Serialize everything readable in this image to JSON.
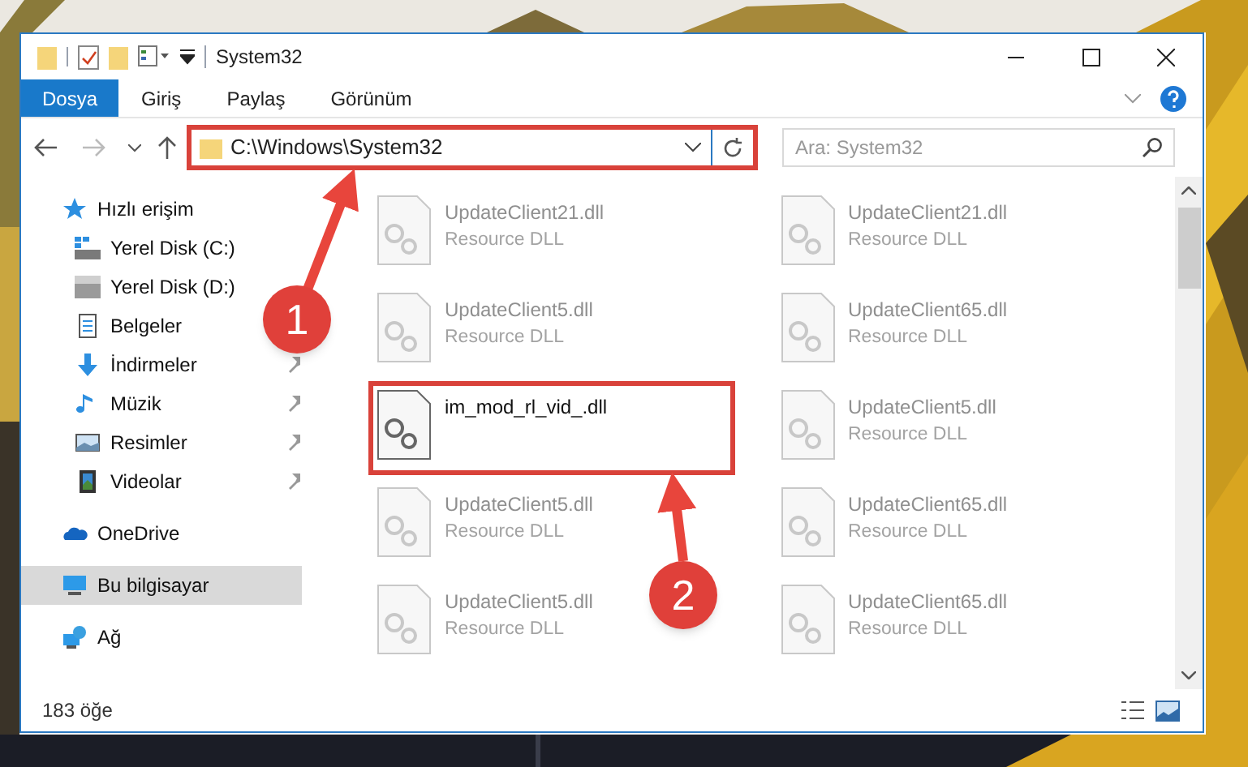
{
  "window": {
    "title": "System32"
  },
  "ribbon_tabs": [
    {
      "label": "Dosya",
      "kind": "file"
    },
    {
      "label": "Giriş",
      "kind": "tab"
    },
    {
      "label": "Paylaş",
      "kind": "tab"
    },
    {
      "label": "Görünüm",
      "kind": "tab"
    }
  ],
  "address_bar": {
    "path": "C:\\Windows\\System32",
    "highlighted": true
  },
  "search": {
    "placeholder": "Ara: System32"
  },
  "navigation": [
    {
      "label": "Hızlı erişim",
      "kind": "star",
      "selected": false,
      "children": [
        {
          "label": "Yerel Disk (C:)",
          "kind": "drive-c",
          "pinned": false,
          "selected": false
        },
        {
          "label": "Yerel Disk (D:)",
          "kind": "drive",
          "pinned": false,
          "selected": false
        },
        {
          "label": "Belgeler",
          "kind": "documents",
          "pinned": false,
          "selected": false
        },
        {
          "label": "İndirmeler",
          "kind": "download",
          "pinned": true,
          "selected": false
        },
        {
          "label": "Müzik",
          "kind": "music",
          "pinned": true,
          "selected": false
        },
        {
          "label": "Resimler",
          "kind": "pictures",
          "pinned": true,
          "selected": false
        },
        {
          "label": "Videolar",
          "kind": "videos",
          "pinned": true,
          "selected": false
        }
      ]
    },
    {
      "label": "OneDrive",
      "kind": "cloud",
      "selected": false
    },
    {
      "label": "Bu bilgisayar",
      "kind": "computer",
      "selected": true
    },
    {
      "label": "Ağ",
      "kind": "network",
      "selected": false
    }
  ],
  "files": [
    {
      "name": "UpdateClient21.dll",
      "type": "Resource DLL",
      "blurred": true,
      "highlighted": false
    },
    {
      "name": "UpdateClient21.dll",
      "type": "Resource DLL",
      "blurred": true,
      "highlighted": false
    },
    {
      "name": "UpdateClient5.dll",
      "type": "Resource DLL",
      "blurred": true,
      "highlighted": false
    },
    {
      "name": "UpdateClient65.dll",
      "type": "Resource DLL",
      "blurred": true,
      "highlighted": false
    },
    {
      "name": "im_mod_rl_vid_.dll",
      "blurred": false,
      "highlighted": true
    },
    {
      "name": "UpdateClient5.dll",
      "type": "Resource DLL",
      "blurred": true,
      "highlighted": false
    },
    {
      "name": "UpdateClient5.dll",
      "type": "Resource DLL",
      "blurred": true,
      "highlighted": false
    },
    {
      "name": "UpdateClient65.dll",
      "type": "Resource DLL",
      "blurred": true,
      "highlighted": false
    },
    {
      "name": "UpdateClient5.dll",
      "type": "Resource DLL",
      "blurred": true,
      "highlighted": false
    },
    {
      "name": "UpdateClient65.dll",
      "type": "Resource DLL",
      "blurred": true,
      "highlighted": false
    }
  ],
  "status_bar": {
    "item_count": "183 öğe"
  },
  "annotations": [
    {
      "label": "1"
    },
    {
      "label": "2"
    }
  ]
}
